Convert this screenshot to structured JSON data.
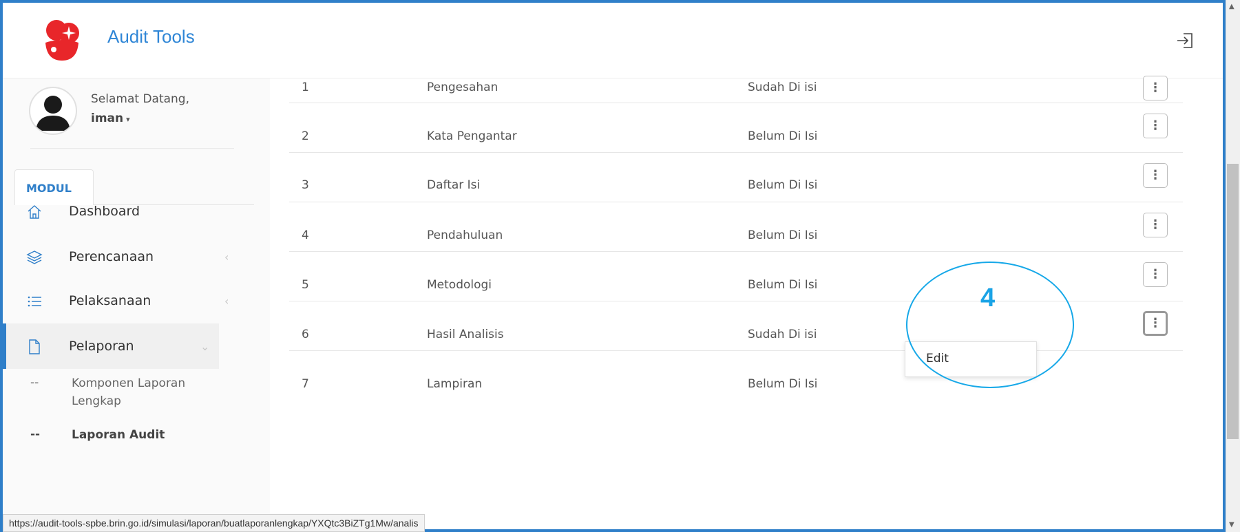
{
  "header": {
    "app_title": "Audit Tools"
  },
  "user": {
    "welcome": "Selamat Datang,",
    "name": "iman"
  },
  "sidebar": {
    "modul_label": "MODUL",
    "items": [
      {
        "label": "Dashboard",
        "icon": "home-icon"
      },
      {
        "label": "Perencanaan",
        "icon": "layers-icon"
      },
      {
        "label": "Pelaksanaan",
        "icon": "list-icon"
      },
      {
        "label": "Pelaporan",
        "icon": "file-icon"
      }
    ],
    "sub_items": [
      {
        "dash": "--",
        "label": "Komponen Laporan Lengkap"
      },
      {
        "dash": "--",
        "label": "Laporan Audit"
      }
    ]
  },
  "table": {
    "rows": [
      {
        "no": "1",
        "name": "Pengesahan",
        "status": "Sudah Di isi"
      },
      {
        "no": "2",
        "name": "Kata Pengantar",
        "status": "Belum Di Isi"
      },
      {
        "no": "3",
        "name": "Daftar Isi",
        "status": "Belum Di Isi"
      },
      {
        "no": "4",
        "name": "Pendahuluan",
        "status": "Belum Di Isi"
      },
      {
        "no": "5",
        "name": "Metodologi",
        "status": "Belum Di Isi"
      },
      {
        "no": "6",
        "name": "Hasil Analisis",
        "status": "Sudah Di isi"
      },
      {
        "no": "7",
        "name": "Lampiran",
        "status": "Belum Di Isi"
      }
    ],
    "kebab_glyph": "⋮"
  },
  "dropdown": {
    "edit_label": "Edit"
  },
  "annotation": {
    "number": "4"
  },
  "status_bar": {
    "url": "https://audit-tools-spbe.brin.go.id/simulasi/laporan/buatlaporanlengkap/YXQtc3BiZTg1Mw/analis"
  },
  "colors": {
    "accent": "#2f7fc9",
    "title": "#2f86d6",
    "annotation": "#16a8e8",
    "logo": "#e8262a"
  }
}
